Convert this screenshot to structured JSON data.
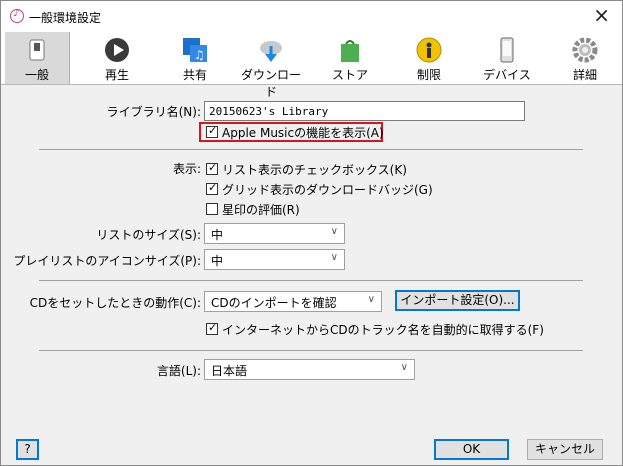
{
  "window": {
    "title": "一般環境設定",
    "close": "×"
  },
  "toolbar": {
    "tabs": [
      {
        "label": "一般"
      },
      {
        "label": "再生"
      },
      {
        "label": "共有"
      },
      {
        "label": "ダウンロード"
      },
      {
        "label": "ストア"
      },
      {
        "label": "制限"
      },
      {
        "label": "デバイス"
      },
      {
        "label": "詳細"
      }
    ]
  },
  "general": {
    "library_label": "ライブラリ名(N):",
    "library_value": "20150623's Library",
    "apple_music": "Apple Musicの機能を表示(A)",
    "display_label": "表示:",
    "list_checkbox": "リスト表示のチェックボックス(K)",
    "grid_badge": "グリッド表示のダウンロードバッジ(G)",
    "star_rating": "星印の評価(R)",
    "list_size_label": "リストのサイズ(S):",
    "list_size_value": "中",
    "playlist_icon_label": "プレイリストのアイコンサイズ(P):",
    "playlist_icon_value": "中",
    "cd_action_label": "CDをセットしたときの動作(C):",
    "cd_action_value": "CDのインポートを確認",
    "import_settings": "インポート設定(O)...",
    "cd_track_names": "インターネットからCDのトラック名を自動的に取得する(F)",
    "language_label": "言語(L):",
    "language_value": "日本語"
  },
  "footer": {
    "help": "?",
    "ok": "OK",
    "cancel": "キャンセル"
  },
  "colors": {
    "highlight_box": "#d9141f",
    "focus_blue": "#0078d7"
  }
}
